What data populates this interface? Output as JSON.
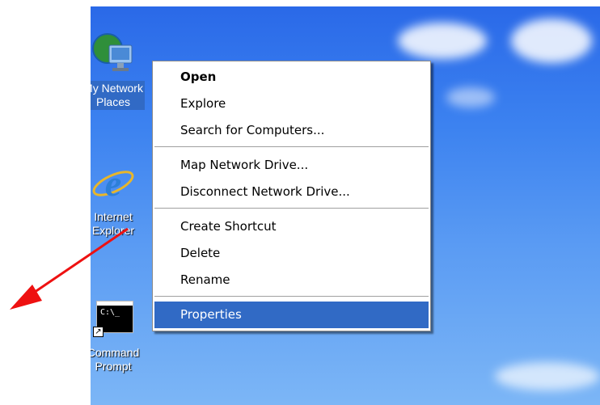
{
  "desktop": {
    "icons": [
      {
        "label": "My Network\nPlaces",
        "icon": "network-places-icon"
      },
      {
        "label": "Internet\nExplorer",
        "icon": "internet-explorer-icon"
      },
      {
        "label": "Command\nPrompt",
        "icon": "command-prompt-icon",
        "glyph_text": "C:\\_"
      }
    ]
  },
  "context_menu": {
    "groups": [
      [
        "Open",
        "Explore",
        "Search for Computers..."
      ],
      [
        "Map Network Drive...",
        "Disconnect Network Drive..."
      ],
      [
        "Create Shortcut",
        "Delete",
        "Rename"
      ],
      [
        "Properties"
      ]
    ],
    "default_item": "Open",
    "highlighted_item": "Properties"
  },
  "annotation": {
    "arrow_color": "#ee1111"
  },
  "colors": {
    "selection": "#316ac5",
    "sky_top": "#2a69e8",
    "sky_bottom": "#7cb6f6"
  }
}
